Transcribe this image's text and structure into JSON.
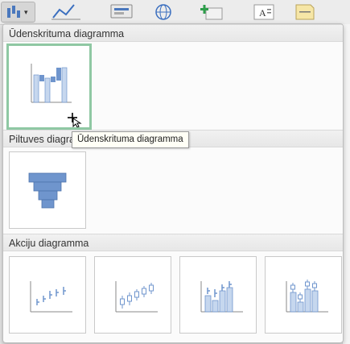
{
  "toolbar": {
    "buttons": [
      {
        "icon": "insert-chart-icon"
      },
      {
        "icon": "line-chart-icon"
      },
      {
        "icon": "smartart-icon"
      },
      {
        "icon": "globe-icon"
      },
      {
        "icon": "new-sheet-icon"
      },
      {
        "icon": "text-box-icon"
      },
      {
        "icon": "note-icon"
      }
    ]
  },
  "gallery": {
    "sections": [
      {
        "title": "Ūdenskrituma diagramma",
        "charts": [
          {
            "icon": "waterfall-chart-icon",
            "selected": true
          }
        ]
      },
      {
        "title": "Piltuves diagramma",
        "charts": [
          {
            "icon": "funnel-chart-icon",
            "selected": false
          }
        ]
      },
      {
        "title": "Akciju diagramma",
        "charts": [
          {
            "icon": "stock-high-low-close-icon"
          },
          {
            "icon": "stock-open-high-low-close-icon"
          },
          {
            "icon": "stock-volume-high-low-close-icon"
          },
          {
            "icon": "stock-volume-open-high-low-close-icon"
          }
        ]
      }
    ]
  },
  "tooltip": {
    "text": "Ūdenskrituma diagramma"
  },
  "colors": {
    "chart_blue": "#6f95cd",
    "chart_blue_light": "#c6d7ee",
    "selection_green": "#8fc8a3",
    "accent_green": "#2e9e4b"
  }
}
